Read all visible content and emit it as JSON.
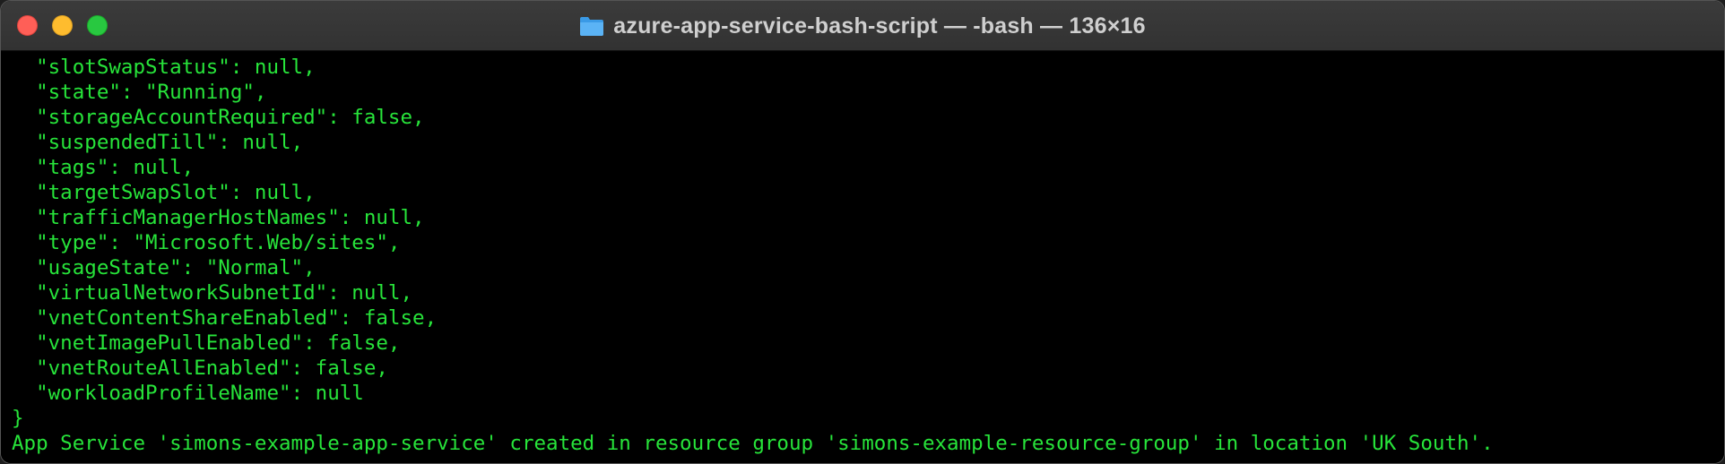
{
  "window": {
    "title": "azure-app-service-bash-script — -bash — 136×16"
  },
  "terminal": {
    "lines": [
      "  \"slotSwapStatus\": null,",
      "  \"state\": \"Running\",",
      "  \"storageAccountRequired\": false,",
      "  \"suspendedTill\": null,",
      "  \"tags\": null,",
      "  \"targetSwapSlot\": null,",
      "  \"trafficManagerHostNames\": null,",
      "  \"type\": \"Microsoft.Web/sites\",",
      "  \"usageState\": \"Normal\",",
      "  \"virtualNetworkSubnetId\": null,",
      "  \"vnetContentShareEnabled\": false,",
      "  \"vnetImagePullEnabled\": false,",
      "  \"vnetRouteAllEnabled\": false,",
      "  \"workloadProfileName\": null",
      "}",
      "App Service 'simons-example-app-service' created in resource group 'simons-example-resource-group' in location 'UK South'."
    ]
  },
  "colors": {
    "terminal_text": "#27e43a",
    "terminal_bg": "#000000",
    "close": "#ff5f57",
    "minimize": "#febc2e",
    "maximize": "#28c840"
  },
  "icons": {
    "folder": "folder-icon"
  }
}
